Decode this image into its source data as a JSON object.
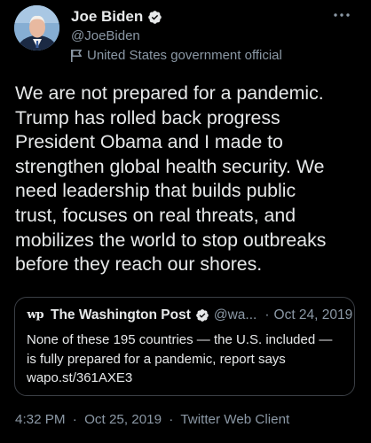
{
  "author": {
    "display_name": "Joe Biden",
    "handle": "@JoeBiden",
    "label": "United States government official",
    "avatar_icon": "profile-photo",
    "verified_icon": "verified-badge-icon",
    "label_icon": "flag-icon"
  },
  "more_icon": "more-options-icon",
  "tweet": {
    "lines": [
      "We are not prepared for a pandemic.",
      "Trump has rolled back progress",
      "President Obama and I made to",
      "strengthen global health security. We",
      "need leadership that builds public",
      "trust, focuses on real threats, and",
      "mobilizes the world to stop outbreaks",
      "before they reach our shores."
    ]
  },
  "quote": {
    "logo_text": "wp",
    "name": "The Washington Post",
    "handle": "@wa...",
    "separator": "·",
    "date": "Oct 24, 2019",
    "lines": [
      "None of these 195 countries — the U.S. included —",
      "is fully prepared for a pandemic, report says",
      "wapo.st/361AXE3"
    ]
  },
  "meta": {
    "time": "4:32 PM",
    "separator": "·",
    "date": "Oct 25, 2019",
    "client": "Twitter Web Client"
  },
  "colors": {
    "background": "#000000",
    "primary_text": "#e7e9ea",
    "secondary_text": "#8b98a5",
    "verified_blue": "#1d9bf0",
    "card_border": "#3b3f45"
  }
}
